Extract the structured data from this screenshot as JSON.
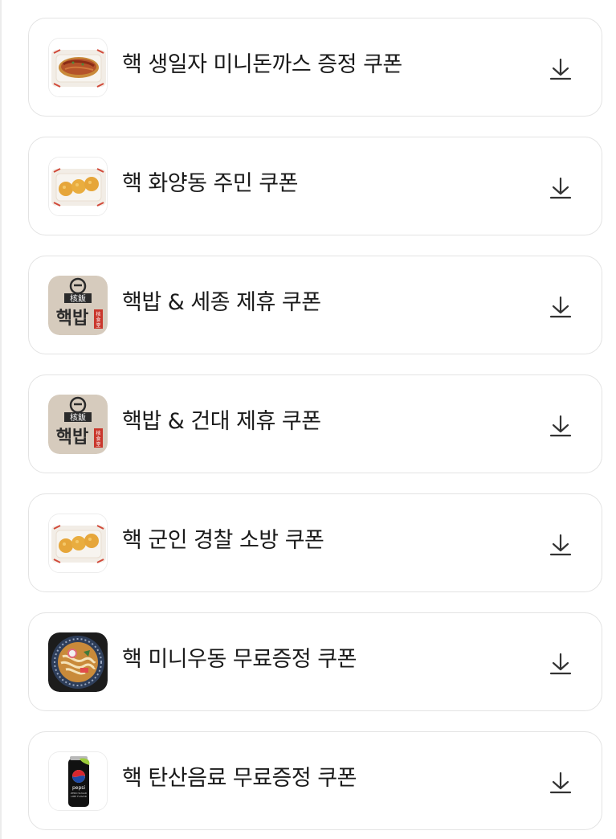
{
  "coupons": [
    {
      "title": "핵 생일자 미니돈까스 증정 쿠폰",
      "icon": "tonkatsu-dish-icon"
    },
    {
      "title": "핵 화양동 주민 쿠폰",
      "icon": "croquette-dish-icon"
    },
    {
      "title": "핵밥 & 세종 제휴 쿠폰",
      "icon": "hackbap-logo-icon"
    },
    {
      "title": "핵밥 & 건대 제휴 쿠폰",
      "icon": "hackbap-logo-icon"
    },
    {
      "title": "핵 군인 경찰 소방 쿠폰",
      "icon": "croquette-dish-icon"
    },
    {
      "title": "핵 미니우동 무료증정 쿠폰",
      "icon": "udon-bowl-icon"
    },
    {
      "title": "핵 탄산음료 무료증정 쿠폰",
      "icon": "pepsi-can-icon"
    }
  ],
  "logo_text": {
    "hanja": "核飯",
    "hangul": "핵밥",
    "side": "核食堂"
  },
  "pepsi_text": {
    "brand": "pepsi",
    "line1": "ZERO SUGAR",
    "line2": "LIME FLAVOR"
  },
  "download_icon": "download-arrow-icon"
}
